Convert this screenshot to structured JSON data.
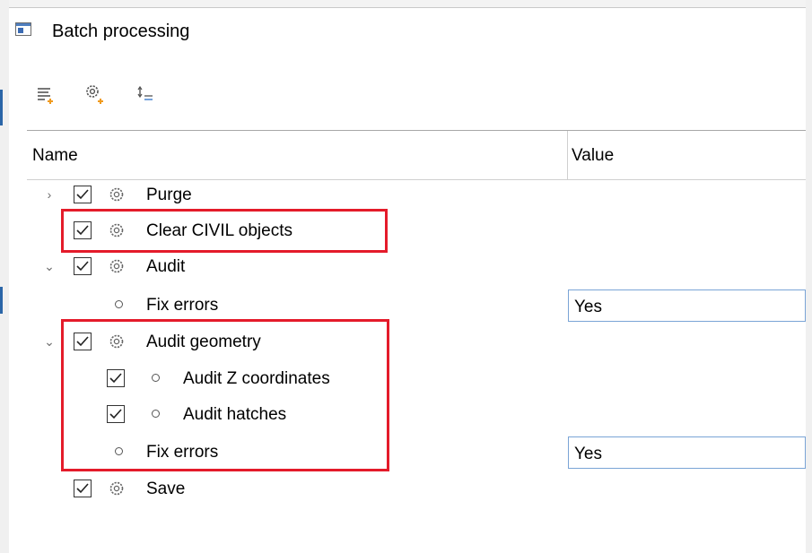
{
  "window": {
    "title": "Batch processing"
  },
  "toolbar": [
    {
      "name": "add-list-icon"
    },
    {
      "name": "add-gear-icon"
    },
    {
      "name": "sort-icon"
    }
  ],
  "grid": {
    "columns": {
      "name": "Name",
      "value": "Value"
    },
    "rows": [
      {
        "id": "purge",
        "label": "Purge",
        "type": "command",
        "checked": true,
        "expander": "collapsed",
        "level": 0
      },
      {
        "id": "clear-civil",
        "label": "Clear CIVIL objects",
        "type": "command",
        "checked": true,
        "expander": "none",
        "level": 0
      },
      {
        "id": "audit",
        "label": "Audit",
        "type": "command",
        "checked": true,
        "expander": "expanded",
        "level": 0
      },
      {
        "id": "audit-fix-errors",
        "label": "Fix errors",
        "type": "option",
        "value": "Yes",
        "level": 1
      },
      {
        "id": "audit-geometry",
        "label": "Audit geometry",
        "type": "command",
        "checked": true,
        "expander": "expanded",
        "level": 0
      },
      {
        "id": "audit-z",
        "label": "Audit Z coordinates",
        "type": "option",
        "checked": true,
        "level": 1
      },
      {
        "id": "audit-hatches",
        "label": "Audit hatches",
        "type": "option",
        "checked": true,
        "level": 1
      },
      {
        "id": "geometry-fix-errors",
        "label": "Fix errors",
        "type": "option",
        "value": "Yes",
        "level": 1
      },
      {
        "id": "save",
        "label": "Save",
        "type": "command",
        "checked": true,
        "expander": "none",
        "level": 0
      }
    ]
  },
  "colors": {
    "highlight": "#e41b2a",
    "value_border": "#7aa4d6",
    "accent": "#3b6bb3"
  }
}
